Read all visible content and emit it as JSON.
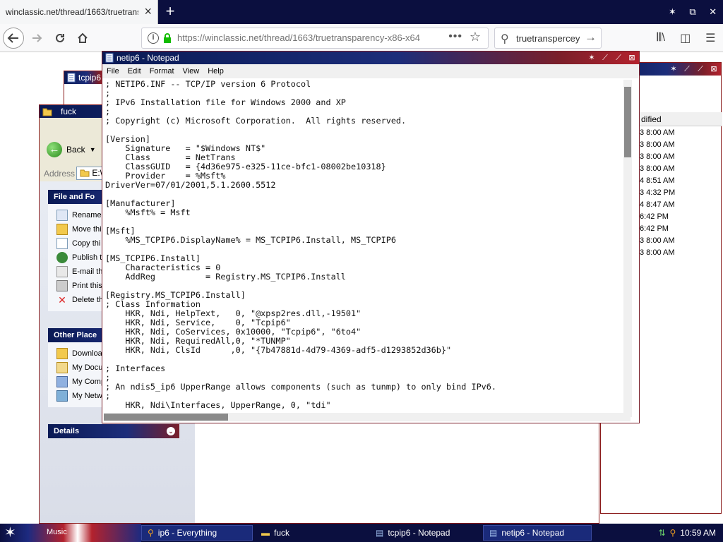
{
  "browser": {
    "tab_title": "winclassic.net/thread/1663/truetransp",
    "tab_close": "×",
    "new_tab": "+",
    "url": "https://winclassic.net/thread/1663/truetransparency-x86-x64",
    "search_query": "truetranspercey",
    "window_controls": [
      "✶",
      "⧉",
      "✕"
    ]
  },
  "tcpip_window": {
    "title": "tcpip6"
  },
  "explorer": {
    "title": "fuck",
    "back_label": "Back",
    "address_label": "Address",
    "address_value": "E:\\",
    "file_folder_tasks": {
      "header": "File and Fo",
      "items": [
        "Rename",
        "Move thi",
        "Copy thi",
        "Publish t",
        "E-mail th",
        "Print this",
        "Delete th"
      ]
    },
    "other_places": {
      "header": "Other Place",
      "items": [
        "Downloa",
        "My Docu",
        "My Comp",
        "My Netw"
      ]
    },
    "details": {
      "header": "Details"
    }
  },
  "everything": {
    "column_header": "dified",
    "rows": [
      "3 8:00 AM",
      "3 8:00 AM",
      "3 8:00 AM",
      "3 8:00 AM",
      "4 8:51 AM",
      "3 4:32 PM",
      "4 8:47 AM",
      "6:42 PM",
      "6:42 PM",
      "3 8:00 AM",
      "3 8:00 AM"
    ]
  },
  "notepad": {
    "title": "netip6 - Notepad",
    "menu": [
      "File",
      "Edit",
      "Format",
      "View",
      "Help"
    ],
    "lines": [
      "; NETIP6.INF -- TCP/IP version 6 Protocol",
      ";",
      "; IPv6 Installation file for Windows 2000 and XP",
      ";",
      "; Copyright (c) Microsoft Corporation.  All rights reserved.",
      "",
      "[Version]",
      "    Signature   = \"$Windows NT$\"",
      "    Class       = NetTrans",
      "    ClassGUID   = {4d36e975-e325-11ce-bfc1-08002be10318}",
      "    Provider    = %Msft%",
      "DriverVer=07/01/2001,5.1.2600.5512",
      "",
      "[Manufacturer]",
      "    %Msft% = Msft",
      "",
      "[Msft]",
      "    %MS_TCPIP6.DisplayName% = MS_TCPIP6.Install, MS_TCPIP6",
      "",
      "[MS_TCPIP6.Install]",
      "    Characteristics = 0",
      "    AddReg          = Registry.MS_TCPIP6.Install",
      "",
      "[Registry.MS_TCPIP6.Install]",
      "; Class Information",
      "    HKR, Ndi, HelpText,   0, \"@xpsp2res.dll,-19501\"",
      "    HKR, Ndi, Service,    0, \"Tcpip6\"",
      "    HKR, Ndi, CoServices, 0x10000, \"Tcpip6\", \"6to4\"",
      "    HKR, Ndi, RequiredAll,0, \"*TUNMP\"",
      "    HKR, Ndi, ClsId      ,0, \"{7b47881d-4d79-4369-adf5-d1293852d36b}\"",
      "",
      "; Interfaces",
      ";",
      "; An ndis5_ip6 UpperRange allows components (such as tunmp) to only bind IPv6.",
      ";",
      "    HKR, Ndi\\Interfaces, UpperRange, 0, \"tdi\""
    ]
  },
  "taskbar": {
    "start_label": "Music",
    "buttons": [
      "ip6 - Everything",
      "fuck",
      "tcpip6 - Notepad",
      "netip6 - Notepad"
    ],
    "clock": "10:59 AM"
  }
}
